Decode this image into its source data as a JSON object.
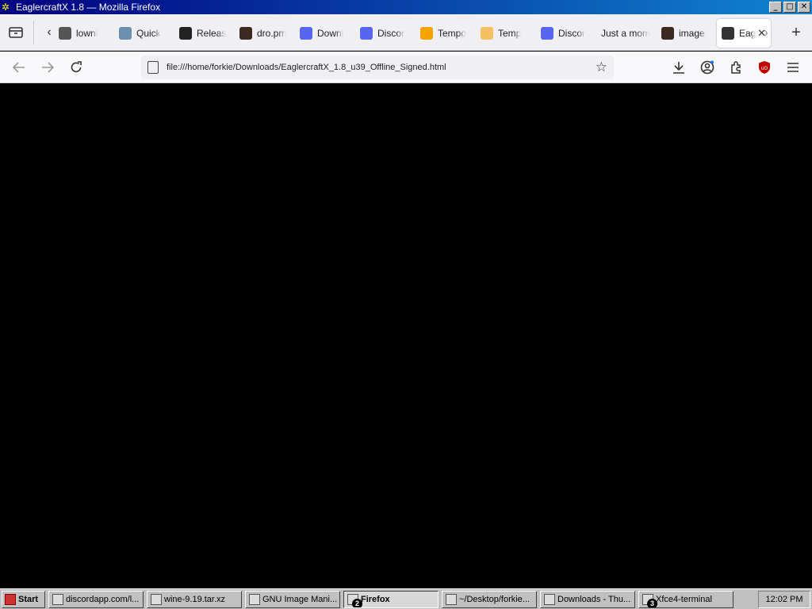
{
  "window": {
    "title": "EaglercraftX 1.8 — Mozilla Firefox",
    "buttons": [
      "_",
      "□",
      "✕"
    ]
  },
  "tabs": [
    {
      "label": "lownl",
      "icon": "arrow-icon",
      "color": "#555555"
    },
    {
      "label": "Quick",
      "icon": "disk-icon",
      "color": "#6b8fb0"
    },
    {
      "label": "Releas",
      "icon": "github-icon",
      "color": "#222222"
    },
    {
      "label": "dro.pm",
      "icon": "image-icon",
      "color": "#3b2a20"
    },
    {
      "label": "Downl",
      "icon": "discord-icon",
      "color": "#5865f2"
    },
    {
      "label": "Discor",
      "icon": "discord-icon",
      "color": "#5865f2"
    },
    {
      "label": "Tempo",
      "icon": "mail-icon",
      "color": "#f4a300"
    },
    {
      "label": "Temp",
      "icon": "mail-open-icon",
      "color": "#f4c060"
    },
    {
      "label": "Discor",
      "icon": "discord-icon",
      "color": "#5865f2"
    },
    {
      "label": "Just a mom",
      "icon": "none",
      "color": "#ffffff"
    },
    {
      "label": "image.",
      "icon": "image-icon",
      "color": "#3b2a20"
    },
    {
      "label": "Eag",
      "icon": "eagler-icon",
      "color": "#333333",
      "active": true
    }
  ],
  "navbar": {
    "url": "file:///home/forkie/Downloads/EaglercraftX_1.8_u39_Offline_Signed.html"
  },
  "taskbar": {
    "start_label": "Start",
    "items": [
      {
        "label": "discordapp.com/l...",
        "pressed": false
      },
      {
        "label": "wine-9.19.tar.xz",
        "pressed": false
      },
      {
        "label": "GNU Image Mani...",
        "pressed": false
      },
      {
        "label": "Firefox",
        "pressed": true,
        "badge": "2"
      },
      {
        "label": "~/Desktop/forkie...",
        "pressed": false
      },
      {
        "label": "Downloads - Thu...",
        "pressed": false
      },
      {
        "label": "Xfce4-terminal",
        "pressed": false,
        "badge": "3"
      }
    ],
    "clock": "12:02 PM"
  }
}
